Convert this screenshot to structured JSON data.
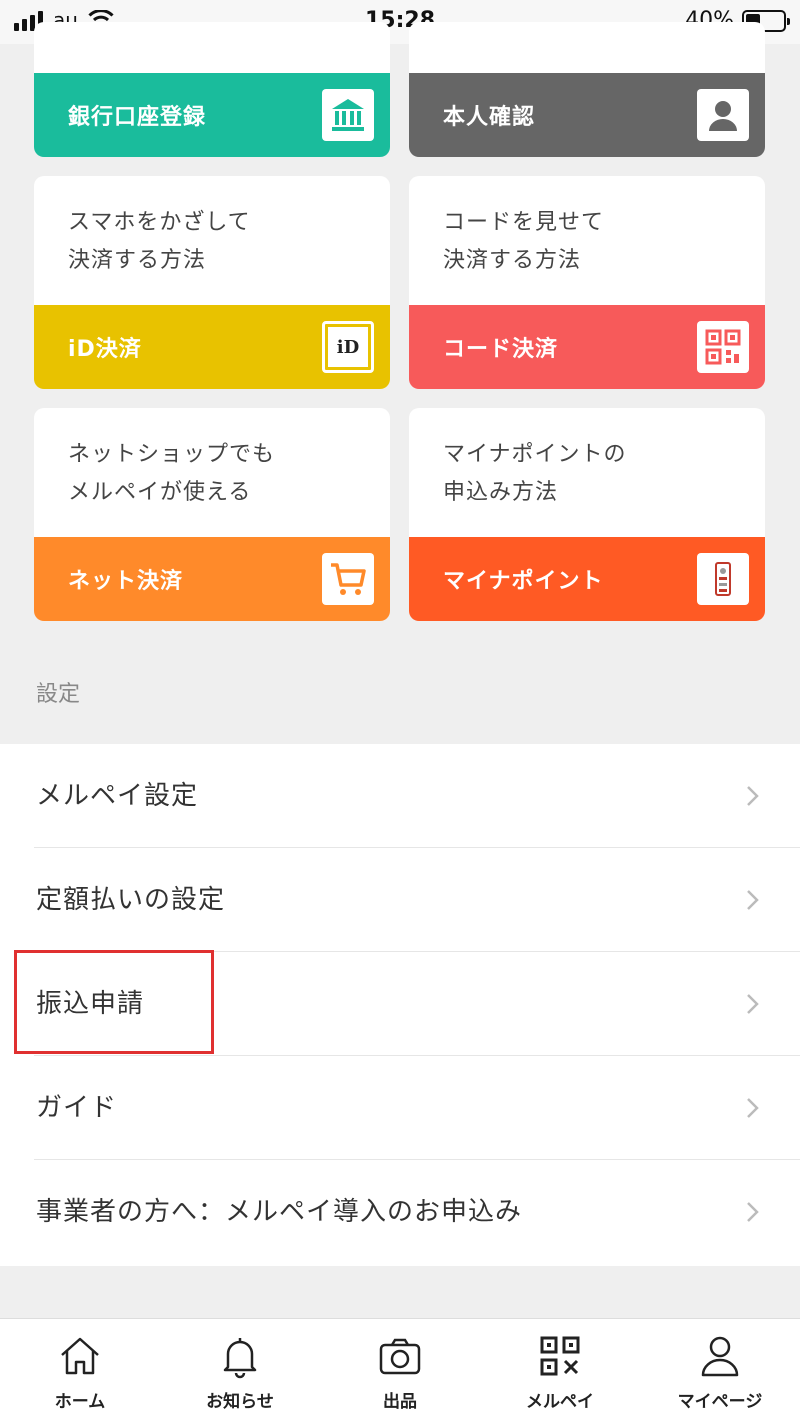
{
  "status_bar": {
    "carrier": "au",
    "time": "15:28",
    "battery": "40%",
    "battery_level": 0.4
  },
  "cards": {
    "bank": {
      "title": "銀行口座登録",
      "color": "#1abc9c"
    },
    "identity": {
      "title": "本人確認",
      "color": "#666666"
    },
    "id_pay": {
      "desc_line1": "スマホをかざして",
      "desc_line2": "決済する方法",
      "title": "iD決済",
      "color": "#e8c200",
      "badge_text": "iD"
    },
    "code_pay": {
      "desc_line1": "コードを見せて",
      "desc_line2": "決済する方法",
      "title": "コード決済",
      "color": "#f75a5a"
    },
    "net_pay": {
      "desc_line1": "ネットショップでも",
      "desc_line2": "メルペイが使える",
      "title": "ネット決済",
      "color": "#ff8a2a"
    },
    "mynapoint": {
      "desc_line1": "マイナポイントの",
      "desc_line2": "申込み方法",
      "title": "マイナポイント",
      "color": "#ff5a24"
    }
  },
  "settings": {
    "section_label": "設定",
    "items": [
      {
        "label": "メルペイ設定"
      },
      {
        "label": "定額払いの設定"
      },
      {
        "label": "振込申請"
      },
      {
        "label": "ガイド"
      },
      {
        "label": "事業者の方へ：メルペイ導入のお申込み"
      }
    ]
  },
  "tab_bar": {
    "items": [
      {
        "label": "ホーム",
        "icon": "home-icon"
      },
      {
        "label": "お知らせ",
        "icon": "bell-icon"
      },
      {
        "label": "出品",
        "icon": "camera-icon"
      },
      {
        "label": "メルペイ",
        "icon": "qr-icon"
      },
      {
        "label": "マイページ",
        "icon": "person-icon"
      }
    ]
  }
}
